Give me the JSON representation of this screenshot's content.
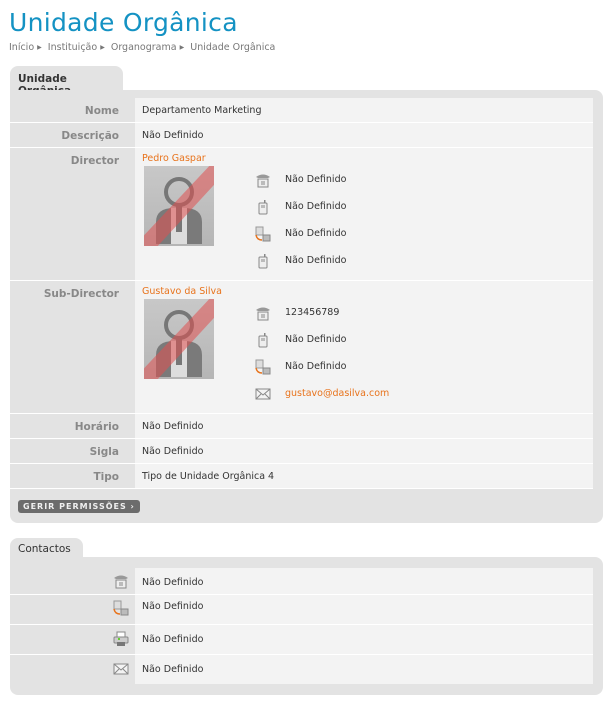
{
  "page": {
    "title": "Unidade Orgânica",
    "breadcrumb": [
      "Início",
      "Instituição",
      "Organograma",
      "Unidade Orgânica"
    ]
  },
  "unit": {
    "tab": "Unidade Orgânica",
    "nome_label": "Nome",
    "nome": "Departamento Marketing",
    "descricao_label": "Descrição",
    "descricao": "Não Definido",
    "director_label": "Director",
    "director": {
      "name": "Pedro Gaspar",
      "contacts": [
        {
          "icon": "phone-icon",
          "value": "Não Definido"
        },
        {
          "icon": "mobile-icon",
          "value": "Não Definido"
        },
        {
          "icon": "phone-fax-icon",
          "value": "Não Definido"
        },
        {
          "icon": "mobile-icon",
          "value": "Não Definido"
        }
      ]
    },
    "subdirector_label": "Sub-Director",
    "subdirector": {
      "name": "Gustavo da Silva",
      "contacts": [
        {
          "icon": "phone-icon",
          "value": "123456789"
        },
        {
          "icon": "mobile-icon",
          "value": "Não Definido"
        },
        {
          "icon": "phone-fax-icon",
          "value": "Não Definido"
        },
        {
          "icon": "email-icon",
          "value": "gustavo@dasilva.com"
        }
      ]
    },
    "horario_label": "Horário",
    "horario": "Não Definido",
    "sigla_label": "Sigla",
    "sigla": "Não Definido",
    "tipo_label": "Tipo",
    "tipo": "Tipo de Unidade Orgânica 4",
    "permissions_button": "GERIR PERMISSÕES ›"
  },
  "contacts": {
    "tab": "Contactos",
    "items": [
      {
        "icon": "phone-icon",
        "value": "Não Definido"
      },
      {
        "icon": "phone-fax-icon",
        "value": "Não Definido"
      },
      {
        "icon": "printer-fax-icon",
        "value": "Não Definido"
      },
      {
        "icon": "email-icon",
        "value": "Não Definido"
      }
    ]
  },
  "colors": {
    "title": "#1492c3",
    "link": "#e8731c",
    "panel": "#e3e3e3"
  }
}
